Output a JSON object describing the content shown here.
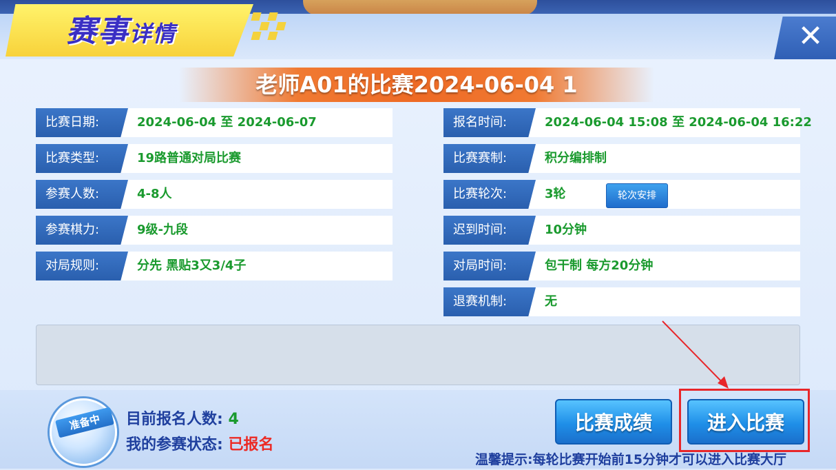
{
  "header": {
    "title_big": "赛事",
    "title_small": "详情",
    "close_label": "✕"
  },
  "match_title": "老师A01的比赛2024-06-04 1",
  "left_rows": [
    {
      "label": "比赛日期:",
      "value": "2024-06-04 至 2024-06-07"
    },
    {
      "label": "比赛类型:",
      "value": "19路普通对局比赛"
    },
    {
      "label": "参赛人数:",
      "value": "4-8人"
    },
    {
      "label": "参赛棋力:",
      "value": "9级-九段"
    },
    {
      "label": "对局规则:",
      "value": "分先 黑贴3又3/4子"
    }
  ],
  "right_rows": [
    {
      "label": "报名时间:",
      "value": "2024-06-04 15:08 至 2024-06-04 16:22"
    },
    {
      "label": "比赛赛制:",
      "value": "积分编排制"
    },
    {
      "label": "比赛轮次:",
      "value": "3轮"
    },
    {
      "label": "迟到时间:",
      "value": "10分钟"
    },
    {
      "label": "对局时间:",
      "value": "包干制 每方20分钟"
    },
    {
      "label": "退赛机制:",
      "value": "无"
    }
  ],
  "round_schedule_button": "轮次安排",
  "footer": {
    "badge_label": "准备中",
    "signup_count_label": "目前报名人数:",
    "signup_count_value": "4",
    "status_label": "我的参赛状态:",
    "status_value": "已报名",
    "results_button": "比赛成绩",
    "enter_button": "进入比赛",
    "tip": "温馨提示:每轮比赛开始前15分钟才可以进入比赛大厅"
  },
  "colors": {
    "label_bg": "#2a5fae",
    "value_green": "#1a9a2e",
    "status_red": "#ec2a24",
    "accent_orange": "#ee6a25",
    "highlight_red": "#e8262a"
  }
}
